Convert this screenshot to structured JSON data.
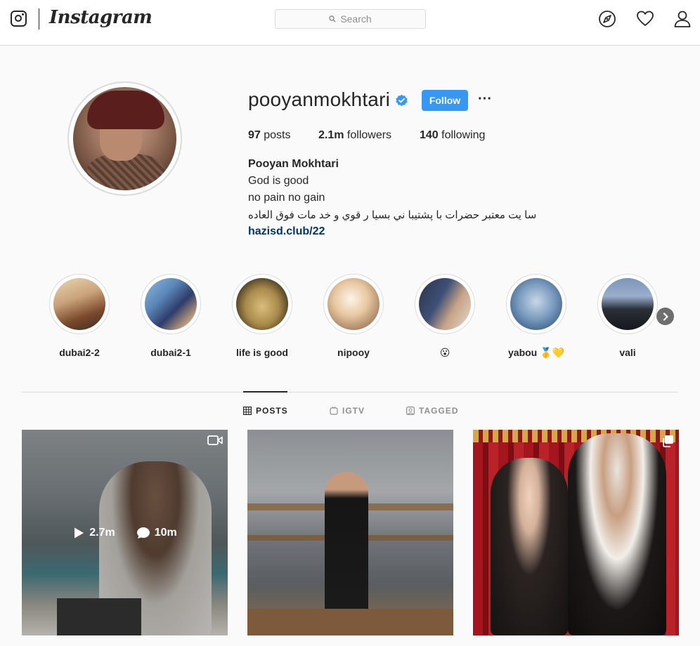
{
  "nav": {
    "wordmark": "Instagram",
    "search_placeholder": "Search"
  },
  "profile": {
    "username": "pooyanmokhtari",
    "verified": true,
    "follow_label": "Follow",
    "more_label": "···",
    "stats": {
      "posts_count": "97",
      "posts_label": "posts",
      "followers_count": "2.1m",
      "followers_label": "followers",
      "following_count": "140",
      "following_label": "following"
    },
    "bio": {
      "name": "Pooyan Mokhtari",
      "lines": [
        "God is good",
        "no pain no gain",
        "سا يت معتبر حضرات با پشتيبا ني بسيا ر قوي و خد مات فوق العاده"
      ],
      "link": "hazisd.club/22"
    }
  },
  "highlights": [
    {
      "label": "dubai2-2"
    },
    {
      "label": "dubai2-1"
    },
    {
      "label": "life is good"
    },
    {
      "label": "nipooy"
    },
    {
      "label": "😮"
    },
    {
      "label": "yabou 🥇💛"
    },
    {
      "label": "vali"
    }
  ],
  "tabs": [
    {
      "label": "POSTS",
      "active": true
    },
    {
      "label": "IGTV",
      "active": false
    },
    {
      "label": "TAGGED",
      "active": false
    }
  ],
  "posts": [
    {
      "type": "video",
      "views": "2.7m",
      "comments": "10m"
    },
    {
      "type": "photo"
    },
    {
      "type": "carousel"
    }
  ],
  "colors": {
    "follow_button": "#3897f0",
    "link": "#003569",
    "verified": "#3897f0",
    "border": "#dbdbdb",
    "background": "#fafafa"
  }
}
